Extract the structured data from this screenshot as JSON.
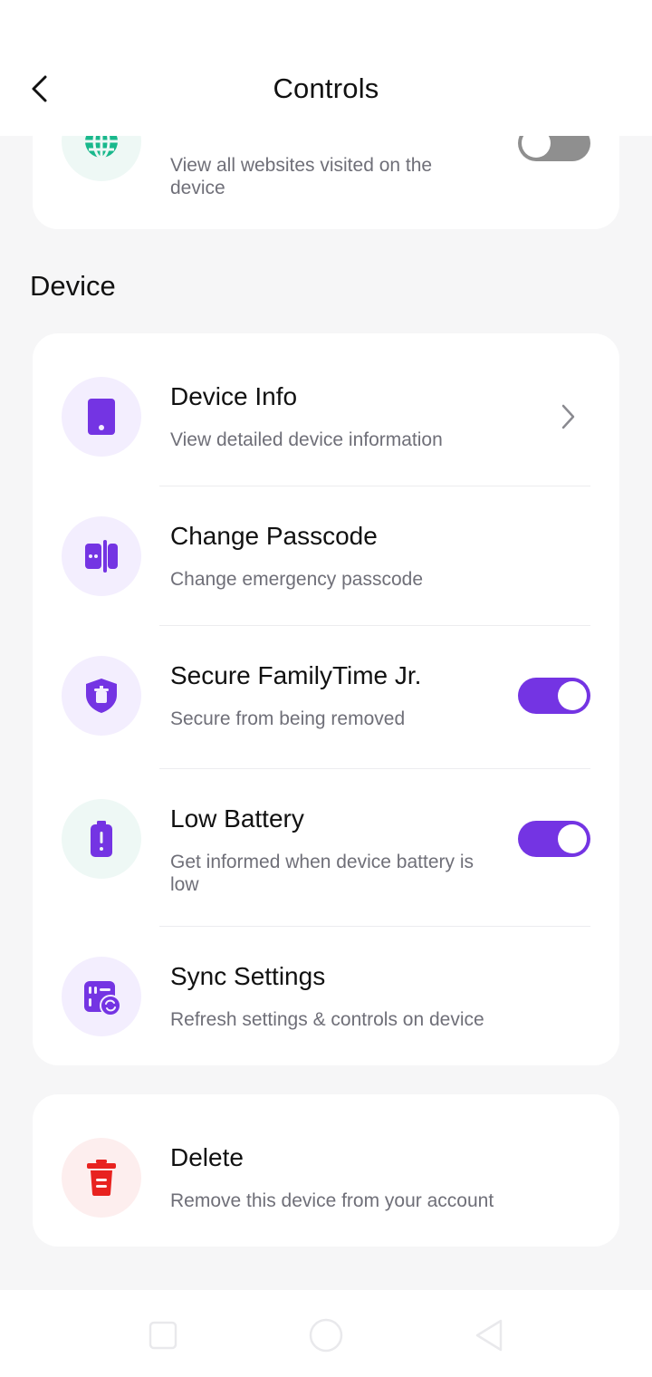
{
  "header": {
    "title": "Controls"
  },
  "top_item": {
    "description": "View all websites visited on the device",
    "toggle_on": false,
    "icon": "globe-icon"
  },
  "section": {
    "title": "Device"
  },
  "device_items": [
    {
      "title": "Device Info",
      "description": "View detailed device information",
      "icon": "phone-icon",
      "control": "chevron"
    },
    {
      "title": "Change Passcode",
      "description": "Change emergency passcode",
      "icon": "passcode-icon",
      "control": "none"
    },
    {
      "title": "Secure FamilyTime Jr.",
      "description": "Secure from being removed",
      "icon": "shield-icon",
      "control": "toggle",
      "toggle_on": true
    },
    {
      "title": "Low Battery",
      "description": "Get informed when device battery is low",
      "icon": "battery-alert-icon",
      "control": "toggle",
      "toggle_on": true
    },
    {
      "title": "Sync Settings",
      "description": "Refresh settings & controls on device",
      "icon": "sync-settings-icon",
      "control": "none"
    }
  ],
  "delete_item": {
    "title": "Delete",
    "description": "Remove this device from your account",
    "icon": "trash-icon"
  },
  "colors": {
    "accent": "#7434e3",
    "green": "#19b88c",
    "danger": "#e8221f"
  },
  "navbar": {
    "icons": [
      "recents-square-icon",
      "home-circle-icon",
      "back-triangle-icon"
    ]
  }
}
